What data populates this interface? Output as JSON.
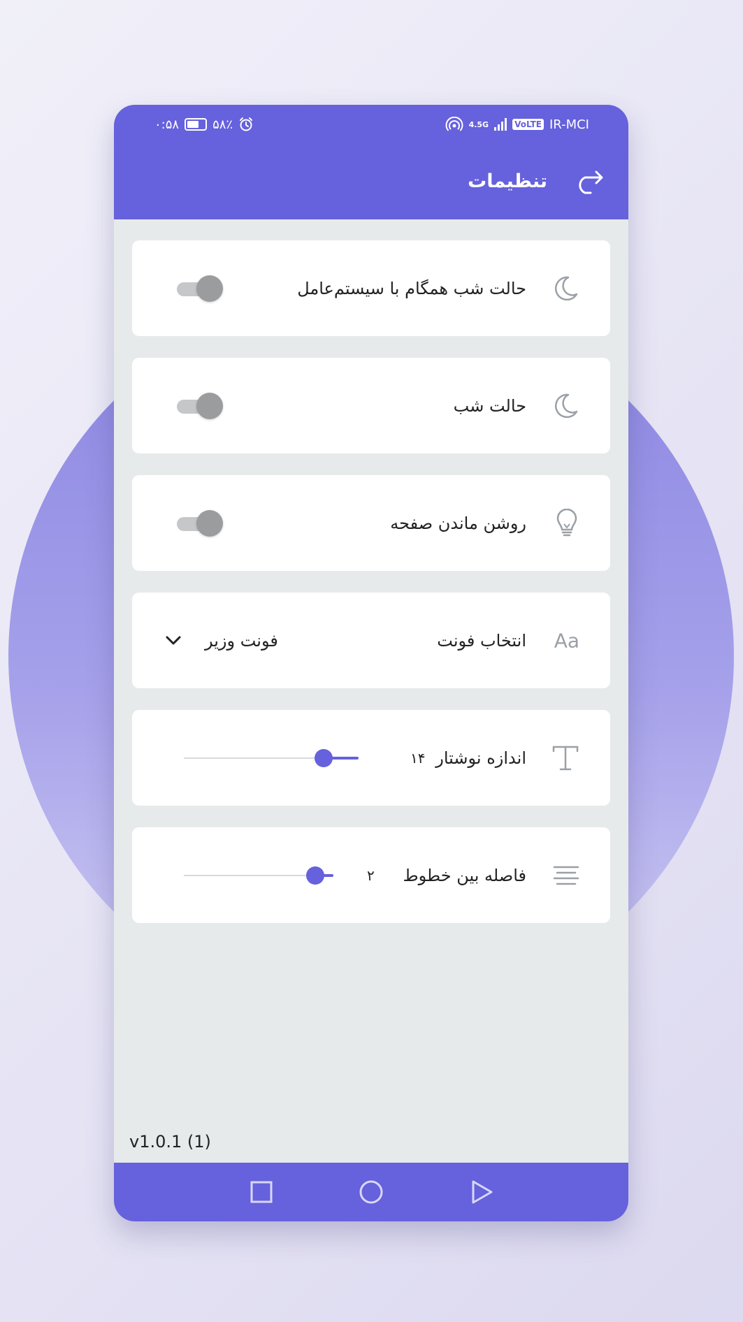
{
  "status_bar": {
    "time": "۰:۵۸",
    "battery": "۵۸٪",
    "carrier": "IR-MCI",
    "volte": "VoLTE",
    "network": "4.5G"
  },
  "header": {
    "title": "تنظیمات"
  },
  "settings": [
    {
      "label": "حالت شب همگام با سیستم‌عامل",
      "type": "toggle",
      "on": false
    },
    {
      "label": "حالت شب",
      "type": "toggle",
      "on": false
    },
    {
      "label": "روشن ماندن صفحه",
      "type": "toggle",
      "on": false
    },
    {
      "label": "انتخاب فونت",
      "type": "select",
      "icon_text": "Aa",
      "value": "فونت وزیر"
    },
    {
      "label": "اندازه نوشتار",
      "type": "slider",
      "value_text": "۱۴",
      "level": 0.2
    },
    {
      "label": "فاصله بین خطوط",
      "type": "slider",
      "value_text": "۲",
      "level": 0.12
    }
  ],
  "version": "v1.0.1 (1)",
  "colors": {
    "accent": "#6661dc",
    "background": "#e6eaea",
    "card": "#ffffff",
    "toggle_off_knob": "#9b9c9e",
    "toggle_off_track": "#c5c7c9"
  },
  "icons": {
    "header_back": "share-arrow-icon",
    "night_sync": "moon-icon",
    "night": "moon-icon",
    "screen_on": "lightbulb-icon",
    "font": "font-aa-icon",
    "text_size": "text-t-icon",
    "line_spacing": "align-lines-icon",
    "nav_recent": "square-icon",
    "nav_home": "circle-icon",
    "nav_back": "triangle-back-icon"
  }
}
